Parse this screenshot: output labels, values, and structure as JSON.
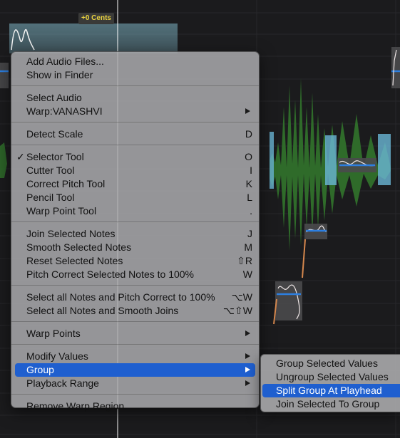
{
  "pitch_readout": "+0 Cents",
  "colors": {
    "menu_highlight": "#1f5fcf",
    "waveform": "#2f6b2a",
    "pitch_line": "#2d7fe0",
    "cents_label": "#e9d23f",
    "playhead": "#ffffff"
  },
  "menu": {
    "groups": [
      [
        {
          "label": "Add Audio Files...",
          "shortcut": ""
        },
        {
          "label": "Show in Finder",
          "shortcut": ""
        }
      ],
      [
        {
          "label": "Select Audio",
          "shortcut": ""
        },
        {
          "label": "Warp:VANASHVI",
          "shortcut": "",
          "submenu": true
        }
      ],
      [
        {
          "label": "Detect Scale",
          "shortcut": "D"
        }
      ],
      [
        {
          "label": "Selector Tool",
          "shortcut": "O",
          "checked": true
        },
        {
          "label": "Cutter Tool",
          "shortcut": "I"
        },
        {
          "label": "Correct Pitch Tool",
          "shortcut": "K"
        },
        {
          "label": "Pencil Tool",
          "shortcut": "L"
        },
        {
          "label": "Warp Point Tool",
          "shortcut": "."
        }
      ],
      [
        {
          "label": "Join Selected Notes",
          "shortcut": "J"
        },
        {
          "label": "Smooth Selected Notes",
          "shortcut": "M"
        },
        {
          "label": "Reset Selected Notes",
          "shortcut": "⇧R"
        },
        {
          "label": "Pitch Correct Selected Notes to 100%",
          "shortcut": "W"
        }
      ],
      [
        {
          "label": "Select all Notes and Pitch Correct to 100%",
          "shortcut": "⌥W"
        },
        {
          "label": "Select all Notes and Smooth Joins",
          "shortcut": "⌥⇧W"
        }
      ],
      [
        {
          "label": "Warp Points",
          "shortcut": "",
          "submenu": true
        }
      ],
      [
        {
          "label": "Modify Values",
          "shortcut": "",
          "submenu": true
        },
        {
          "label": "Group",
          "shortcut": "",
          "submenu": true,
          "highlighted": true
        },
        {
          "label": "Playback Range",
          "shortcut": "",
          "submenu": true
        }
      ],
      [
        {
          "label": "Remove Warp Region",
          "shortcut": ""
        }
      ]
    ]
  },
  "group_submenu": {
    "items": [
      {
        "label": "Group Selected Values"
      },
      {
        "label": "Ungroup Selected Values"
      },
      {
        "label": "Split Group At Playhead",
        "highlighted": true
      },
      {
        "label": "Join Selected To Group"
      }
    ]
  }
}
